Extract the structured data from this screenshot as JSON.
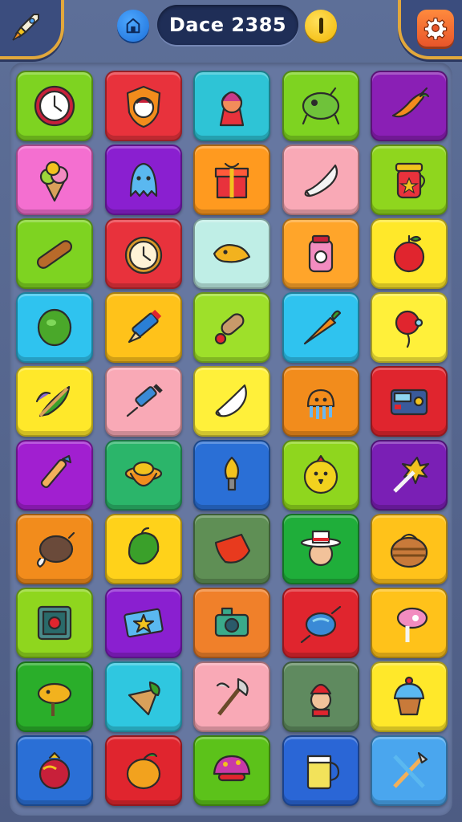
{
  "header": {
    "title": "Dace 2385",
    "left_corner_icon": "rocket-icon",
    "home_icon": "home-icon",
    "coin_icon": "coin-icon",
    "settings_icon": "gear-icon",
    "colors": {
      "frame_gold": "#e2a83c",
      "pill": "#1f2e57",
      "settings": "#f26b32",
      "coin": "#f5c518",
      "home": "#2f86ea"
    }
  },
  "board": {
    "columns": 5,
    "rows": 10,
    "tiles": [
      {
        "color": "#7ed321",
        "icon": "clock"
      },
      {
        "color": "#e8323c",
        "icon": "shield-face"
      },
      {
        "color": "#2ec4d6",
        "icon": "doll"
      },
      {
        "color": "#7ed321",
        "icon": "green-creature"
      },
      {
        "color": "#8a1fb5",
        "icon": "chili-pepper"
      },
      {
        "color": "#f46fd0",
        "icon": "ice-cream-cone"
      },
      {
        "color": "#8a1fd0",
        "icon": "blue-ghost"
      },
      {
        "color": "#ff9a1f",
        "icon": "gift-box"
      },
      {
        "color": "#f9a9b6",
        "icon": "paper-scroll"
      },
      {
        "color": "#8fd61e",
        "icon": "jam-jar"
      },
      {
        "color": "#7ed321",
        "icon": "bread-stick"
      },
      {
        "color": "#e8323c",
        "icon": "pocket-watch"
      },
      {
        "color": "#bfeee6",
        "icon": "yellow-fish"
      },
      {
        "color": "#ffa52a",
        "icon": "camera-jar"
      },
      {
        "color": "#ffe82a",
        "icon": "apple"
      },
      {
        "color": "#2fc3ef",
        "icon": "green-bean"
      },
      {
        "color": "#ffc21a",
        "icon": "pencil"
      },
      {
        "color": "#9ee02a",
        "icon": "glue-stick"
      },
      {
        "color": "#2fc3ef",
        "icon": "carrot"
      },
      {
        "color": "#fff03a",
        "icon": "balloon"
      },
      {
        "color": "#ffe82a",
        "icon": "feather-quill"
      },
      {
        "color": "#f9a9b6",
        "icon": "syringe-pen"
      },
      {
        "color": "#fff03a",
        "icon": "paper-fold"
      },
      {
        "color": "#f28c1c",
        "icon": "jellyfish-robot"
      },
      {
        "color": "#e0252e",
        "icon": "radio-panel"
      },
      {
        "color": "#a11fd0",
        "icon": "paintbrush"
      },
      {
        "color": "#2bb56a",
        "icon": "spinning-top"
      },
      {
        "color": "#2a6fd6",
        "icon": "light-bulb"
      },
      {
        "color": "#8fd61e",
        "icon": "yellow-chick"
      },
      {
        "color": "#7a1fb5",
        "icon": "spark-brush"
      },
      {
        "color": "#f28c1c",
        "icon": "roast-meat"
      },
      {
        "color": "#ffd21a",
        "icon": "green-pepper"
      },
      {
        "color": "#5f8f55",
        "icon": "red-leaf"
      },
      {
        "color": "#1fae3a",
        "icon": "hat-face"
      },
      {
        "color": "#ffc21a",
        "icon": "basket"
      },
      {
        "color": "#8fd61e",
        "icon": "gem-frame"
      },
      {
        "color": "#8a1fd0",
        "icon": "star-card"
      },
      {
        "color": "#f0802a",
        "icon": "camera"
      },
      {
        "color": "#e0252e",
        "icon": "wrapped-candy"
      },
      {
        "color": "#ffc21a",
        "icon": "lollipop-sign"
      },
      {
        "color": "#2aae2a",
        "icon": "fish-on-stick"
      },
      {
        "color": "#2fc7e0",
        "icon": "waffle-cone"
      },
      {
        "color": "#f9a9b6",
        "icon": "axe"
      },
      {
        "color": "#5f8a5f",
        "icon": "fire-kid"
      },
      {
        "color": "#ffe82a",
        "icon": "cupcake"
      },
      {
        "color": "#2a6fd6",
        "icon": "pomegranate"
      },
      {
        "color": "#e0252e",
        "icon": "orange-fruit"
      },
      {
        "color": "#5cc21a",
        "icon": "purple-mushroom"
      },
      {
        "color": "#2a66d6",
        "icon": "beer-mug"
      },
      {
        "color": "#4aa6ee",
        "icon": "crossed-tools"
      }
    ]
  }
}
